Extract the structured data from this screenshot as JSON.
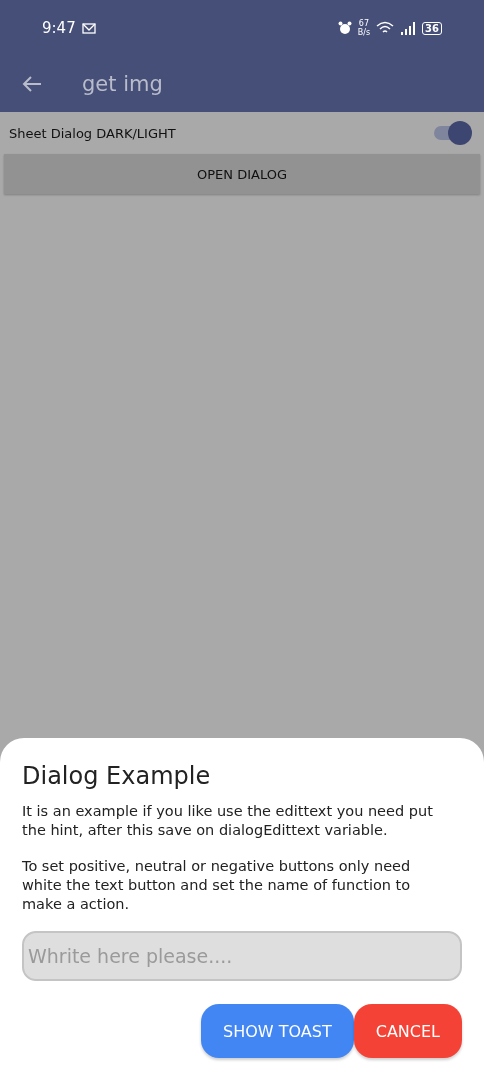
{
  "status_bar": {
    "time": "9:47",
    "speed_value": "67",
    "speed_unit": "B/s",
    "battery": "36"
  },
  "app_bar": {
    "title": "get img"
  },
  "switch_row": {
    "label": "Sheet Dialog DARK/LIGHT",
    "on": true
  },
  "open_button": {
    "label": "OPEN DIALOG"
  },
  "dialog": {
    "title": "Dialog Example",
    "paragraphs": [
      "It is an example if you like use the edittext you need put the hint, after this save on  dialogEdittext variable.",
      "To set positive, neutral or negative buttons only need white the text button and set the name of function to make a action."
    ],
    "input": {
      "placeholder": "Whrite here please...."
    },
    "buttons": [
      {
        "label": "SHOW TOAST",
        "kind": "positive"
      },
      {
        "label": "CANCEL",
        "kind": "negative"
      }
    ]
  }
}
